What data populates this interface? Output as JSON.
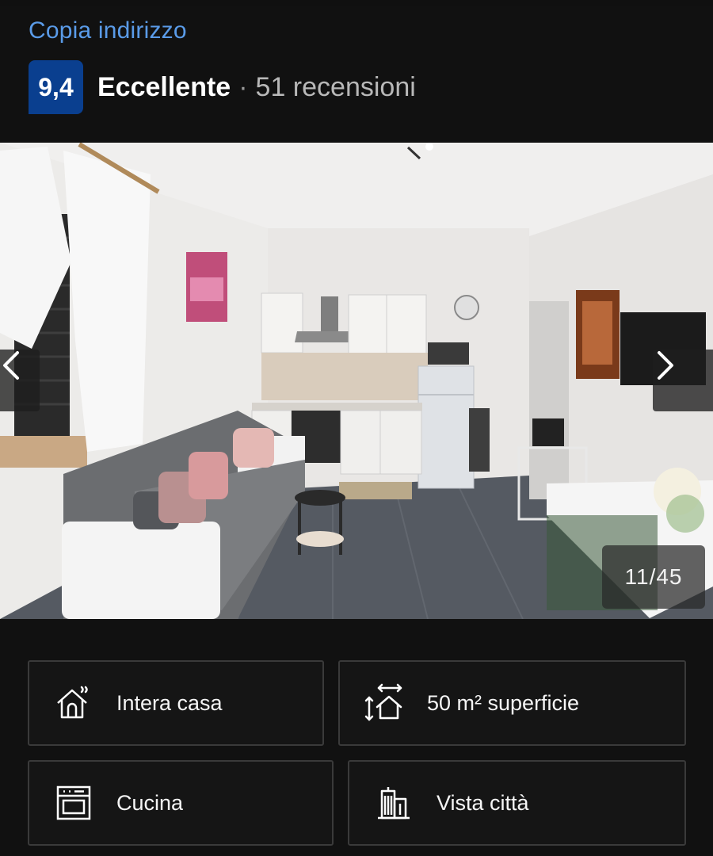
{
  "header": {
    "copy_address_label": "Copia indirizzo",
    "rating": {
      "score": "9,4",
      "label": "Eccellente",
      "separator": "·",
      "reviews": "51 recensioni",
      "badge_color": "#0a3f8f"
    }
  },
  "gallery": {
    "counter": "11/45",
    "prev_icon": "chevron-left-icon",
    "next_icon": "chevron-right-icon"
  },
  "features": [
    {
      "icon": "house-icon",
      "label": "Intera casa"
    },
    {
      "icon": "floor-area-icon",
      "label": "50 m² superficie"
    },
    {
      "icon": "oven-icon",
      "label": "Cucina"
    },
    {
      "icon": "city-buildings-icon",
      "label": "Vista città"
    }
  ],
  "colors": {
    "background": "#111111",
    "link": "#5a9be8",
    "card_border": "#3a3a3a"
  }
}
